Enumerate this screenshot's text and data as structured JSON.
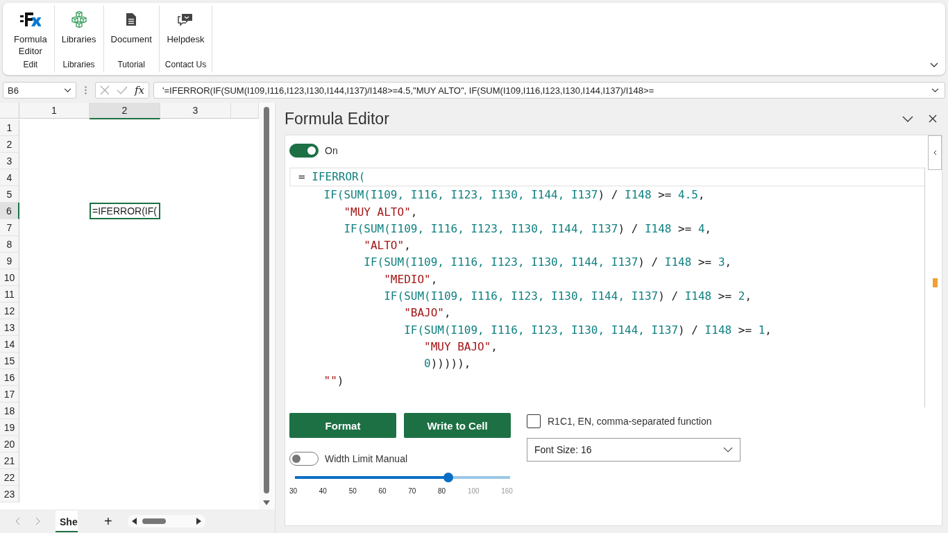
{
  "ribbon": {
    "groups": [
      {
        "label": "Edit",
        "buttons": [
          "Formula\nEditor"
        ]
      },
      {
        "label": "Libraries",
        "buttons": [
          "Libraries"
        ]
      },
      {
        "label": "Tutorial",
        "buttons": [
          "Document"
        ]
      },
      {
        "label": "Contact Us",
        "buttons": [
          "Helpdesk"
        ]
      }
    ]
  },
  "formula_bar": {
    "name_box": "B6",
    "fx": "fx",
    "formula": "'=IFERROR(IF(SUM(I109,I116,I123,I130,I144,I137)/I148>=4.5,\"MUY ALTO\", IF(SUM(I109,I116,I123,I130,I144,I137)/I148>="
  },
  "sheet": {
    "columns": [
      {
        "label": "1",
        "selected": false
      },
      {
        "label": "2",
        "selected": true
      },
      {
        "label": "3",
        "selected": false
      }
    ],
    "rows": [
      {
        "label": "1",
        "selected": false
      },
      {
        "label": "2",
        "selected": false
      },
      {
        "label": "3",
        "selected": false
      },
      {
        "label": "4",
        "selected": false
      },
      {
        "label": "5",
        "selected": false
      },
      {
        "label": "6",
        "selected": true
      },
      {
        "label": "7",
        "selected": false
      },
      {
        "label": "8",
        "selected": false
      },
      {
        "label": "9",
        "selected": false
      },
      {
        "label": "10",
        "selected": false
      },
      {
        "label": "11",
        "selected": false
      },
      {
        "label": "12",
        "selected": false
      },
      {
        "label": "13",
        "selected": false
      },
      {
        "label": "14",
        "selected": false
      },
      {
        "label": "15",
        "selected": false
      },
      {
        "label": "16",
        "selected": false
      },
      {
        "label": "17",
        "selected": false
      },
      {
        "label": "18",
        "selected": false
      },
      {
        "label": "19",
        "selected": false
      },
      {
        "label": "20",
        "selected": false
      },
      {
        "label": "21",
        "selected": false
      },
      {
        "label": "22",
        "selected": false
      },
      {
        "label": "23",
        "selected": false
      }
    ],
    "active_cell": "=IFERROR(IF(",
    "tabs": [
      {
        "label": "She",
        "selected": true
      }
    ],
    "add_tab": "+"
  },
  "pane": {
    "title": "Formula Editor",
    "toggle": {
      "label": "On",
      "on": true
    },
    "code_lines": [
      [
        {
          "text": "= ",
          "kind": "op"
        },
        {
          "text": "IFERROR(",
          "kind": "fn"
        }
      ],
      [
        {
          "text": "    IF(SUM(I109, I116, I123, I130, I144, I137",
          "kind": "fn"
        },
        {
          "text": ") / ",
          "kind": "op"
        },
        {
          "text": "I148",
          "kind": "fn"
        },
        {
          "text": " >= ",
          "kind": "op"
        },
        {
          "text": "4.5",
          "kind": "fn"
        },
        {
          "text": ",",
          "kind": "op"
        }
      ],
      [
        {
          "text": "       \"MUY ALTO\"",
          "kind": "str"
        },
        {
          "text": ",",
          "kind": "op"
        }
      ],
      [
        {
          "text": "       IF(SUM(I109, I116, I123, I130, I144, I137",
          "kind": "fn"
        },
        {
          "text": ") / ",
          "kind": "op"
        },
        {
          "text": "I148",
          "kind": "fn"
        },
        {
          "text": " >= ",
          "kind": "op"
        },
        {
          "text": "4",
          "kind": "fn"
        },
        {
          "text": ",",
          "kind": "op"
        }
      ],
      [
        {
          "text": "          \"ALTO\"",
          "kind": "str"
        },
        {
          "text": ",",
          "kind": "op"
        }
      ],
      [
        {
          "text": "          IF(SUM(I109, I116, I123, I130, I144, I137",
          "kind": "fn"
        },
        {
          "text": ") / ",
          "kind": "op"
        },
        {
          "text": "I148",
          "kind": "fn"
        },
        {
          "text": " >= ",
          "kind": "op"
        },
        {
          "text": "3",
          "kind": "fn"
        },
        {
          "text": ",",
          "kind": "op"
        }
      ],
      [
        {
          "text": "             \"MEDIO\"",
          "kind": "str"
        },
        {
          "text": ",",
          "kind": "op"
        }
      ],
      [
        {
          "text": "             IF(SUM(I109, I116, I123, I130, I144, I137",
          "kind": "fn"
        },
        {
          "text": ") / ",
          "kind": "op"
        },
        {
          "text": "I148",
          "kind": "fn"
        },
        {
          "text": " >= ",
          "kind": "op"
        },
        {
          "text": "2",
          "kind": "fn"
        },
        {
          "text": ",",
          "kind": "op"
        }
      ],
      [
        {
          "text": "                \"BAJO\"",
          "kind": "str"
        },
        {
          "text": ",",
          "kind": "op"
        }
      ],
      [
        {
          "text": "                IF(SUM(I109, I116, I123, I130, I144, I137",
          "kind": "fn"
        },
        {
          "text": ") / ",
          "kind": "op"
        },
        {
          "text": "I148",
          "kind": "fn"
        },
        {
          "text": " >= ",
          "kind": "op"
        },
        {
          "text": "1",
          "kind": "fn"
        },
        {
          "text": ",",
          "kind": "op"
        }
      ],
      [
        {
          "text": "                   \"MUY BAJO\"",
          "kind": "str"
        },
        {
          "text": ",",
          "kind": "op"
        }
      ],
      [
        {
          "text": "                   0",
          "kind": "fn"
        },
        {
          "text": "))))),",
          "kind": "op"
        }
      ],
      [
        {
          "text": "    \"\"",
          "kind": "str"
        },
        {
          "text": ")",
          "kind": "op"
        }
      ]
    ],
    "buttons": [
      "Format",
      "Write to Cell"
    ],
    "option": {
      "label": "R1C1, EN, comma-separated function",
      "checked": false
    },
    "width_limit": {
      "label": "Width Limit Manual",
      "on": false
    },
    "slider": {
      "level": 0.714,
      "ticks": [
        "30",
        "40",
        "50",
        "60",
        "70",
        "80",
        "100",
        "160"
      ]
    },
    "font_size": {
      "value": "Font Size: 16"
    }
  }
}
